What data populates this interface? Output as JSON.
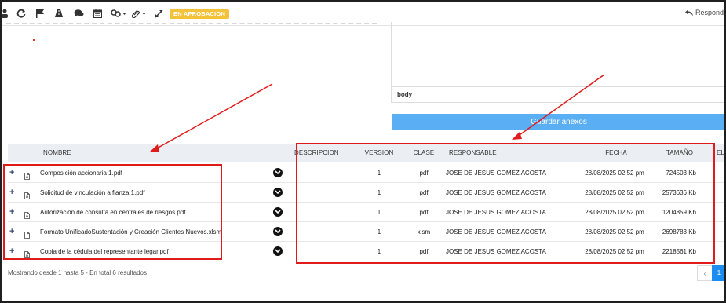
{
  "toolbar": {
    "status_badge": "EN APROBACION",
    "reply_label": "Responder",
    "icons": [
      "user-icon",
      "refresh-icon",
      "flag-icon",
      "road-icon",
      "comments-icon",
      "calendar-icon",
      "link-icon",
      "paperclip-icon",
      "expand-icon",
      "reply-icon"
    ]
  },
  "editor": {
    "footer_path": "body"
  },
  "save_button_label": "Guardar anexos",
  "table": {
    "headers": {
      "nombre": "NOMBRE",
      "descripcion": "DESCRIPCION",
      "version": "VERSION",
      "clase": "CLASE",
      "responsable": "RESPONSABLE",
      "fecha": "FECHA",
      "tamano": "TAMAÑO",
      "extra": "EL"
    },
    "rows": [
      {
        "nombre": "Composición accionaria 1.pdf",
        "descripcion": "",
        "version": "1",
        "clase": "pdf",
        "responsable": "JOSE DE JESUS GOMEZ ACOSTA",
        "fecha": "28/08/2025 02:52 pm",
        "tamano": "724503 Kb",
        "icon": "pdf-file-icon"
      },
      {
        "nombre": "Solicitud de vinculación a fianza 1.pdf",
        "descripcion": "",
        "version": "1",
        "clase": "pdf",
        "responsable": "JOSE DE JESUS GOMEZ ACOSTA",
        "fecha": "28/08/2025 02:52 pm",
        "tamano": "2573636 Kb",
        "icon": "pdf-file-icon"
      },
      {
        "nombre": "Autorización de consulta en centrales de riesgos.pdf",
        "descripcion": "",
        "version": "1",
        "clase": "pdf",
        "responsable": "JOSE DE JESUS GOMEZ ACOSTA",
        "fecha": "28/08/2025 02:52 pm",
        "tamano": "1204859 Kb",
        "icon": "pdf-file-icon"
      },
      {
        "nombre": "Formato UnificadoSustentación y Creación Clientes Nuevos.xlsm",
        "descripcion": "",
        "version": "1",
        "clase": "xlsm",
        "responsable": "JOSE DE JESUS GOMEZ ACOSTA",
        "fecha": "28/08/2025 02:52 pm",
        "tamano": "2698783 Kb",
        "icon": "file-icon"
      },
      {
        "nombre": "Copia de la cédula del representante legar.pdf",
        "descripcion": "",
        "version": "1",
        "clase": "pdf",
        "responsable": "JOSE DE JESUS GOMEZ ACOSTA",
        "fecha": "28/08/2025 02:52 pm",
        "tamano": "2218561 Kb",
        "icon": "pdf-file-icon"
      }
    ]
  },
  "footer": {
    "summary": "Mostrando desde 1 hasta 5 - En total 6 resultados",
    "prev_label": "‹",
    "current_page": "1"
  },
  "colors": {
    "accent_button": "#5aaef3",
    "badge": "#f4c23a",
    "annotation": "#e01b1b",
    "page_active": "#1b8df0"
  }
}
